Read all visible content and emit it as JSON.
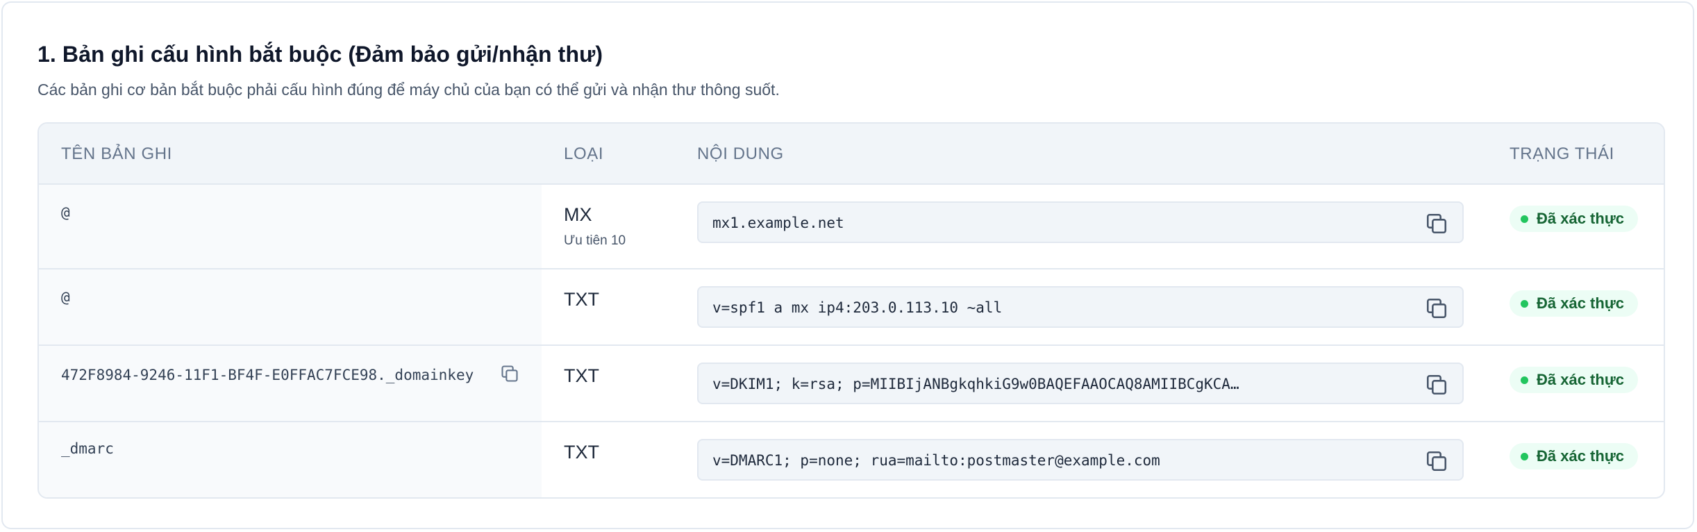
{
  "section": {
    "title": "1. Bản ghi cấu hình bắt buộc (Đảm bảo gửi/nhận thư)",
    "description": "Các bản ghi cơ bản bắt buộc phải cấu hình đúng để máy chủ của bạn có thể gửi và nhận thư thông suốt."
  },
  "table": {
    "headers": {
      "name": "TÊN BẢN GHI",
      "type": "LOẠI",
      "content": "NỘI DUNG",
      "status": "TRẠNG THÁI"
    },
    "rows": [
      {
        "name": "@",
        "type": "MX",
        "sub": "Ưu tiên 10",
        "value": "mx1.example.net",
        "status": "Đã xác thực"
      },
      {
        "name": "@",
        "type": "TXT",
        "value": "v=spf1 a mx ip4:203.0.113.10 ~all",
        "status": "Đã xác thực"
      },
      {
        "name": "472F8984-9246-11F1-BF4F-E0FFAC7FCE98._domainkey",
        "type": "TXT",
        "value": "v=DKIM1; k=rsa; p=MIIBIjANBgkqhkiG9w0BAQEFAAOCAQ8AMIIBCgKCA…",
        "status": "Đã xác thực"
      },
      {
        "name": "_dmarc",
        "type": "TXT",
        "value": "v=DMARC1; p=none; rua=mailto:postmaster@example.com",
        "status": "Đã xác thực"
      }
    ]
  },
  "icons": {
    "copy": "copy-icon",
    "status_dot": "status-dot-icon"
  },
  "colors": {
    "verified_text": "#166534",
    "verified_bg": "#ecfdf5",
    "verified_dot": "#22c55e",
    "header_bg": "#f1f5f9"
  }
}
